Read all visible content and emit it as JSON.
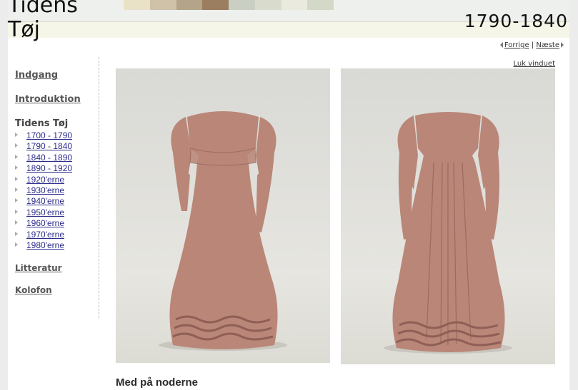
{
  "site": {
    "title_line1": "Tidens",
    "title_line2": "Tøj"
  },
  "header": {
    "period": "1790-1840"
  },
  "pager": {
    "prev_label": "Forrige",
    "separator": "|",
    "next_label": "Næste"
  },
  "close_window_label": "Luk vinduet",
  "sidebar": {
    "entrance": "Indgang",
    "introduction": "Introduktion",
    "section_heading": "Tidens Tøj",
    "eras": [
      "1700 - 1790",
      "1790 - 1840",
      "1840 - 1890",
      "1890 - 1920",
      "1920'erne",
      "1930'erne",
      "1940'erne",
      "1950'erne",
      "1960'erne",
      "1970'erne",
      "1980'erne"
    ],
    "literature": "Litteratur",
    "colophon": "Kolofon"
  },
  "content": {
    "heading": "Med på noderne",
    "dress_color": "#b98678"
  }
}
